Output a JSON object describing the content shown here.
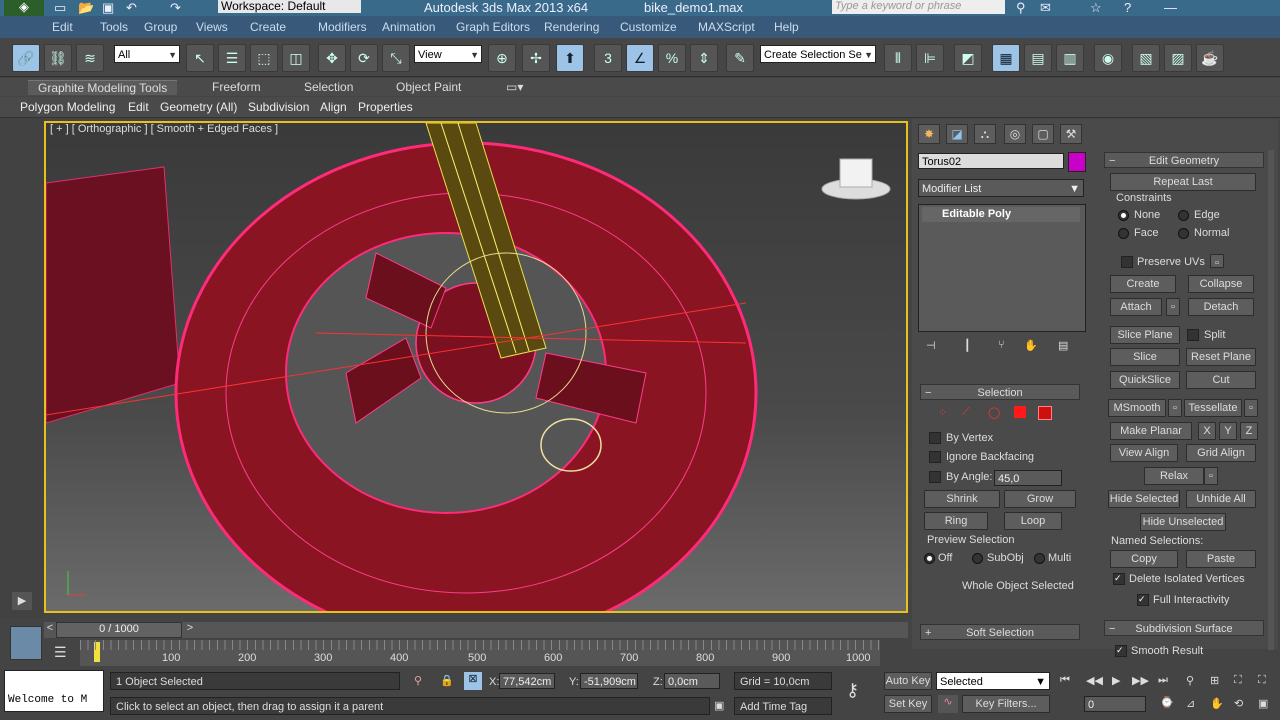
{
  "titlebar": {
    "workspace": "Workspace: Default",
    "app_title": "Autodesk 3ds Max  2013 x64",
    "file": "bike_demo1.max",
    "search_placeholder": "Type a keyword or phrase"
  },
  "menubar": {
    "items": [
      "Edit",
      "Tools",
      "Group",
      "Views",
      "Create",
      "Modifiers",
      "Animation",
      "Graph Editors",
      "Rendering",
      "Customize",
      "MAXScript",
      "Help"
    ]
  },
  "toolbar": {
    "filter": "All",
    "coord": "View",
    "selection_set": "Create Selection Se"
  },
  "ribbon": {
    "tabs": [
      "Graphite Modeling Tools",
      "Freeform",
      "Selection",
      "Object Paint"
    ],
    "sub": [
      "Polygon Modeling",
      "Edit",
      "Geometry (All)",
      "Subdivision",
      "Align",
      "Properties"
    ]
  },
  "viewport": {
    "label": "[ + ] [ Orthographic ] [ Smooth + Edged Faces ]"
  },
  "command": {
    "object_name": "Torus02",
    "object_color": "#c800c8",
    "modifier_list": "Modifier List",
    "stack_item": "Editable Poly",
    "selection": {
      "title": "Selection",
      "by_vertex": "By Vertex",
      "ignore_backfacing": "Ignore Backfacing",
      "by_angle": "By Angle:",
      "angle": "45,0",
      "shrink": "Shrink",
      "grow": "Grow",
      "ring": "Ring",
      "loop": "Loop",
      "preview": "Preview Selection",
      "off": "Off",
      "subobj": "SubObj",
      "multi": "Multi",
      "status": "Whole Object Selected"
    },
    "soft_selection": "Soft Selection",
    "edit_geometry": {
      "title": "Edit Geometry",
      "repeat_last": "Repeat Last",
      "constraints": "Constraints",
      "none": "None",
      "edge": "Edge",
      "face": "Face",
      "normal": "Normal",
      "preserve_uvs": "Preserve UVs",
      "create": "Create",
      "collapse": "Collapse",
      "attach": "Attach",
      "detach": "Detach",
      "slice_plane": "Slice Plane",
      "split": "Split",
      "slice": "Slice",
      "reset_plane": "Reset Plane",
      "quickslice": "QuickSlice",
      "cut": "Cut",
      "msmooth": "MSmooth",
      "tessellate": "Tessellate",
      "make_planar": "Make Planar",
      "x": "X",
      "y": "Y",
      "z": "Z",
      "view_align": "View Align",
      "grid_align": "Grid Align",
      "relax": "Relax",
      "hide_selected": "Hide Selected",
      "unhide_all": "Unhide All",
      "hide_unselected": "Hide Unselected",
      "named_selections": "Named Selections:",
      "copy": "Copy",
      "paste": "Paste",
      "delete_isolated": "Delete Isolated Vertices",
      "full_interactivity": "Full Interactivity"
    },
    "subdivision": {
      "title": "Subdivision Surface",
      "smooth_result": "Smooth Result"
    }
  },
  "timeline": {
    "frame": "0 / 1000",
    "ticks": [
      "100",
      "200",
      "300",
      "400",
      "500",
      "600",
      "700",
      "800",
      "900",
      "1000"
    ]
  },
  "status": {
    "selected": "1 Object Selected",
    "prompt": "Click to select an object, then drag to assign it a parent",
    "listener": "Welcome to M",
    "x_label": "X:",
    "x": "77,542cm",
    "y_label": "Y:",
    "y": "-51,909cm",
    "z_label": "Z:",
    "z": "0,0cm",
    "grid": "Grid = 10,0cm",
    "add_time_tag": "Add Time Tag",
    "auto_key": "Auto Key",
    "set_key": "Set Key",
    "key_mode": "Selected",
    "key_filters": "Key Filters...",
    "frame_field": "0"
  }
}
